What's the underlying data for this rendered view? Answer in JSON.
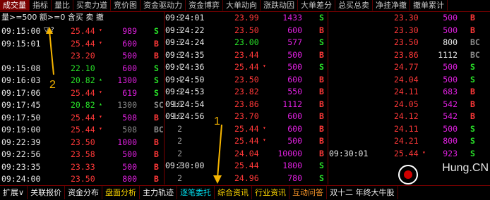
{
  "top_tabs": [
    "成交量",
    "指标",
    "量比",
    "买卖力道",
    "竞价图",
    "资金驱动力",
    "资金博弈",
    "大单动向",
    "涨跌动因",
    "大单差分",
    "总买总卖",
    "净挂净撤",
    "撤单累计"
  ],
  "active_top_tab": 0,
  "filter_text": "量>=500 额>=0 含买 卖 撤",
  "annotation_1": "1",
  "annotation_2": "2",
  "qmarks": "▽ ?",
  "left_rows": [
    {
      "time": "09:15:00",
      "price": "25.44",
      "dir": "up",
      "tick": "▾",
      "vol": "989",
      "volc": "big",
      "bs": "S"
    },
    {
      "time": "09:15:01",
      "price": "25.44",
      "dir": "up",
      "tick": "▾",
      "vol": "600",
      "volc": "big",
      "bs": "B"
    },
    {
      "time": "",
      "price": "23.20",
      "dir": "up",
      "tick": "",
      "vol": "500",
      "volc": "big",
      "bs": "B"
    },
    {
      "time": "09:15:08",
      "price": "22.10",
      "dir": "down",
      "tick": "",
      "vol": "600",
      "volc": "big",
      "bs": "S"
    },
    {
      "time": "09:16:03",
      "price": "20.82",
      "dir": "down",
      "tick": "▴",
      "vol": "1300",
      "volc": "big",
      "bs": "S"
    },
    {
      "time": "09:17:06",
      "price": "25.44",
      "dir": "up",
      "tick": "▾",
      "vol": "619",
      "volc": "big",
      "bs": "S"
    },
    {
      "time": "09:17:45",
      "price": "20.82",
      "dir": "down",
      "tick": "▴",
      "vol": "1300",
      "volc": "dim",
      "bs": "SC"
    },
    {
      "time": "09:17:50",
      "price": "25.44",
      "dir": "up",
      "tick": "▾",
      "vol": "508",
      "volc": "big",
      "bs": "B"
    },
    {
      "time": "09:19:00",
      "price": "25.44",
      "dir": "up",
      "tick": "▾",
      "vol": "508",
      "volc": "dim",
      "bs": "BC"
    },
    {
      "time": "09:22:39",
      "price": "23.50",
      "dir": "up",
      "tick": "",
      "vol": "1000",
      "volc": "big",
      "bs": "B"
    },
    {
      "time": "09:22:56",
      "price": "23.58",
      "dir": "up",
      "tick": "",
      "vol": "500",
      "volc": "big",
      "bs": "B"
    },
    {
      "time": "09:23:35",
      "price": "23.33",
      "dir": "up",
      "tick": "",
      "vol": "500",
      "volc": "big",
      "bs": "B"
    },
    {
      "time": "09:24:00",
      "price": "23.50",
      "dir": "up",
      "tick": "",
      "vol": "800",
      "volc": "big",
      "bs": "B"
    }
  ],
  "mid_rows": [
    {
      "time": "09:24:01",
      "price": "23.99",
      "dir": "up",
      "tick": "",
      "vol": "1433",
      "volc": "big",
      "bs": "S",
      "cnt": "3"
    },
    {
      "time": "09:24:22",
      "price": "23.50",
      "dir": "up",
      "tick": "",
      "vol": "600",
      "volc": "big",
      "bs": "B",
      "cnt": "3"
    },
    {
      "time": "09:24:24",
      "price": "23.00",
      "dir": "down",
      "tick": "",
      "vol": "577",
      "volc": "big",
      "bs": "S",
      "cnt": "3"
    },
    {
      "time": "09:24:35",
      "price": "23.44",
      "dir": "up",
      "tick": "",
      "vol": "500",
      "volc": "big",
      "bs": "B",
      "cnt": "3"
    },
    {
      "time": "09:24:36",
      "price": "25.44",
      "dir": "up",
      "tick": "▾",
      "vol": "500",
      "volc": "big",
      "bs": "S",
      "cnt": "4"
    },
    {
      "time": "09:24:50",
      "price": "23.50",
      "dir": "up",
      "tick": "",
      "vol": "600",
      "volc": "big",
      "bs": "B",
      "cnt": "4"
    },
    {
      "time": "09:24:53",
      "price": "23.82",
      "dir": "up",
      "tick": "",
      "vol": "550",
      "volc": "big",
      "bs": "B",
      "cnt": "9"
    },
    {
      "time": "09:24:54",
      "price": "23.86",
      "dir": "up",
      "tick": "",
      "vol": "1112",
      "volc": "big",
      "bs": "B",
      "cnt": "10"
    },
    {
      "time": "09:24:56",
      "price": "23.70",
      "dir": "up",
      "tick": "",
      "vol": "600",
      "volc": "big",
      "bs": "B",
      "cnt": "10"
    },
    {
      "time": "",
      "price": "25.44",
      "dir": "up",
      "tick": "▾",
      "vol": "600",
      "volc": "big",
      "bs": "B",
      "cnt": "2"
    },
    {
      "time": "",
      "price": "25.44",
      "dir": "up",
      "tick": "▾",
      "vol": "500",
      "volc": "big",
      "bs": "B",
      "cnt": "2"
    },
    {
      "time": "",
      "price": "24.04",
      "dir": "up",
      "tick": "",
      "vol": "10000",
      "volc": "big",
      "bs": "B",
      "cnt": "2"
    },
    {
      "time": "09:30:00",
      "price": "25.44",
      "dir": "up",
      "tick": "",
      "vol": "1800",
      "volc": "big",
      "bs": "S",
      "cnt": "2"
    },
    {
      "time": "",
      "price": "24.96",
      "dir": "up",
      "tick": "",
      "vol": "780",
      "volc": "big",
      "bs": "S",
      "cnt": "2"
    }
  ],
  "right_rows": [
    {
      "time": "",
      "price": "23.30",
      "dir": "up",
      "tick": "",
      "vol": "500",
      "volc": "big",
      "bs": "B"
    },
    {
      "time": "",
      "price": "23.30",
      "dir": "up",
      "tick": "",
      "vol": "500",
      "volc": "big",
      "bs": "B"
    },
    {
      "time": "",
      "price": "23.50",
      "dir": "up",
      "tick": "",
      "vol": "800",
      "volc": "norm",
      "bs": "BC"
    },
    {
      "time": "",
      "price": "23.86",
      "dir": "up",
      "tick": "",
      "vol": "1112",
      "volc": "norm",
      "bs": "BC"
    },
    {
      "time": "",
      "price": "24.77",
      "dir": "up",
      "tick": "",
      "vol": "500",
      "volc": "big",
      "bs": "S"
    },
    {
      "time": "",
      "price": "24.04",
      "dir": "up",
      "tick": "",
      "vol": "500",
      "volc": "big",
      "bs": "S"
    },
    {
      "time": "",
      "price": "24.11",
      "dir": "up",
      "tick": "",
      "vol": "683",
      "volc": "big",
      "bs": "B"
    },
    {
      "time": "",
      "price": "24.05",
      "dir": "up",
      "tick": "",
      "vol": "542",
      "volc": "big",
      "bs": "B"
    },
    {
      "time": "",
      "price": "24.12",
      "dir": "up",
      "tick": "",
      "vol": "542",
      "volc": "big",
      "bs": "B"
    },
    {
      "time": "",
      "price": "24.11",
      "dir": "up",
      "tick": "",
      "vol": "500",
      "volc": "big",
      "bs": "S"
    },
    {
      "time": "",
      "price": "24.21",
      "dir": "up",
      "tick": "",
      "vol": "800",
      "volc": "big",
      "bs": "S"
    },
    {
      "time": "09:30:01",
      "price": "25.44",
      "dir": "up",
      "tick": "▾",
      "vol": "923",
      "volc": "big",
      "bs": "S"
    },
    {
      "time": "",
      "price": "",
      "dir": "up",
      "tick": "",
      "vol": "",
      "volc": "big",
      "bs": ""
    },
    {
      "time": "",
      "price": "",
      "dir": "up",
      "tick": "",
      "vol": "",
      "volc": "big",
      "bs": ""
    }
  ],
  "bottom_tabs": [
    {
      "label": "扩展∨",
      "cls": ""
    },
    {
      "label": "关联报价",
      "cls": ""
    },
    {
      "label": "资金分布",
      "cls": ""
    },
    {
      "label": "盘面分析",
      "cls": "y"
    },
    {
      "label": "主力轨迹",
      "cls": ""
    },
    {
      "label": "逐笔委托",
      "cls": "cy"
    },
    {
      "label": "综合资讯",
      "cls": "y"
    },
    {
      "label": "行业资讯",
      "cls": "y"
    },
    {
      "label": "互动问答",
      "cls": "orange"
    },
    {
      "label": "双十二 年终大牛股",
      "cls": ""
    }
  ],
  "watermark": "Hung.CN",
  "colors": {
    "up": "#ff3838",
    "down": "#28e028",
    "volume_big": "#e020e0",
    "border": "#7a0000"
  }
}
